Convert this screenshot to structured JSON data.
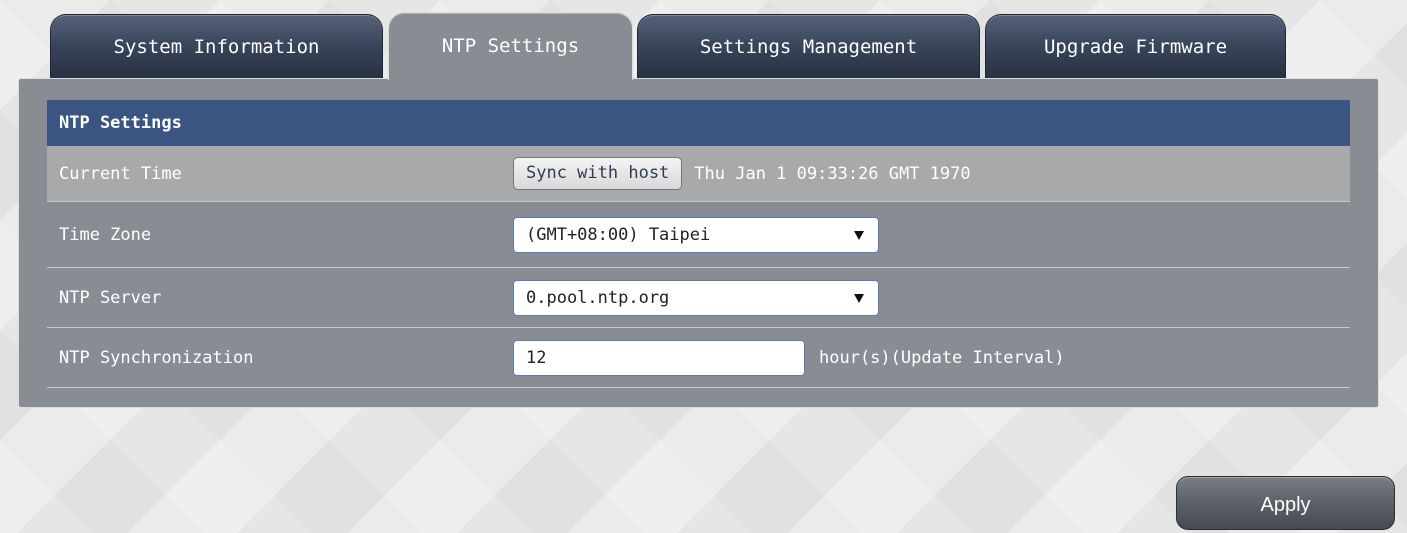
{
  "tabs": [
    {
      "label": "System Information",
      "active": false
    },
    {
      "label": "NTP Settings",
      "active": true
    },
    {
      "label": "Settings Management",
      "active": false
    },
    {
      "label": "Upgrade Firmware",
      "active": false
    }
  ],
  "panel": {
    "section_title": "NTP Settings",
    "rows": {
      "current_time": {
        "label": "Current Time",
        "button_label": "Sync with host",
        "time_value": "Thu Jan 1 09:33:26 GMT 1970"
      },
      "time_zone": {
        "label": "Time Zone",
        "selected": "(GMT+08:00) Taipei"
      },
      "ntp_server": {
        "label": "NTP Server",
        "selected": "0.pool.ntp.org"
      },
      "ntp_sync": {
        "label": "NTP Synchronization",
        "value": "12",
        "unit": "hour(s)(Update Interval)"
      }
    }
  },
  "footer": {
    "apply_label": "Apply"
  },
  "colors": {
    "section_header": "#3b5582",
    "panel_bg": "#888d94",
    "tab_dark": "#3a465c",
    "row_highlight": "#a7a9ab"
  },
  "icons": {
    "dropdown": "dropdown-arrow-icon"
  }
}
